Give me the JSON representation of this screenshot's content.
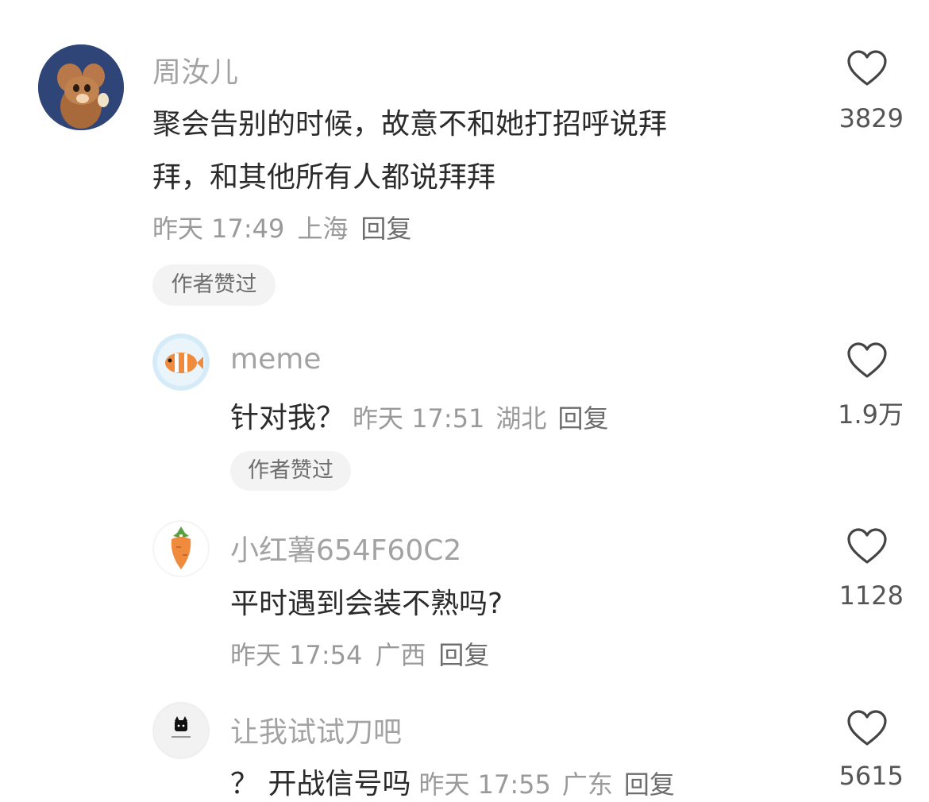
{
  "comments": [
    {
      "username": "周汝儿",
      "text_line1": "聚会告别的时候，故意不和她打招呼说拜",
      "text_line2": "拜，和其他所有人都说拜拜",
      "time": "昨天 17:49",
      "location": "上海",
      "reply": "回复",
      "badge": "作者赞过",
      "likes": "3829",
      "avatar_icon": "cartoon-mouse-avatar"
    },
    {
      "username": "meme",
      "text": "针对我？",
      "time": "昨天 17:51",
      "location": "湖北",
      "reply": "回复",
      "badge": "作者赞过",
      "likes": "1.9万",
      "avatar_icon": "clownfish-avatar"
    },
    {
      "username": "小红薯654F60C2",
      "text": "平时遇到会装不熟吗?",
      "time": "昨天 17:54",
      "location": "广西",
      "reply": "回复",
      "likes": "1128",
      "avatar_icon": "carrot-avatar"
    },
    {
      "username": "让我试试刀吧",
      "text": "？ 开战信号吗",
      "time": "昨天 17:55",
      "location": "广东",
      "reply": "回复",
      "likes": "5615",
      "avatar_icon": "black-cat-avatar"
    }
  ],
  "colors": {
    "username": "#a3a3a3",
    "text": "#2b2b2b",
    "meta": "#9a9a9a",
    "badge_bg": "#f3f3f3"
  }
}
